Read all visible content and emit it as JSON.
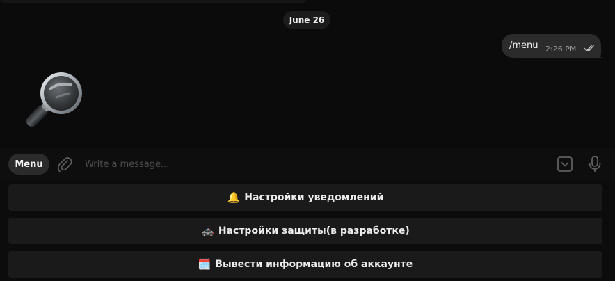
{
  "chat": {
    "date_separator": "June 26",
    "outgoing_message": {
      "text": "/menu",
      "time": "2:26 PM",
      "status_icon": "double-check-icon"
    },
    "sticker": "magnifying-glass-sticker"
  },
  "composer": {
    "menu_label": "Menu",
    "attach_icon": "paperclip-icon",
    "placeholder": "Write a message...",
    "value": "",
    "commands_icon": "bot-commands-icon",
    "mic_icon": "microphone-icon"
  },
  "keyboard": {
    "buttons": [
      {
        "emoji": "🔔",
        "label": "Настройки уведомлений"
      },
      {
        "emoji": "🚓",
        "label": "Настройки защиты(в разработке)"
      },
      {
        "emoji": "🗓️",
        "label": "Вывести информацию об аккаунте"
      }
    ]
  },
  "colors": {
    "background": "#0b0b0b",
    "bubble": "#2b2b2b",
    "keyboard_button": "#1a1a1a",
    "muted_text": "#9a9a9a"
  }
}
